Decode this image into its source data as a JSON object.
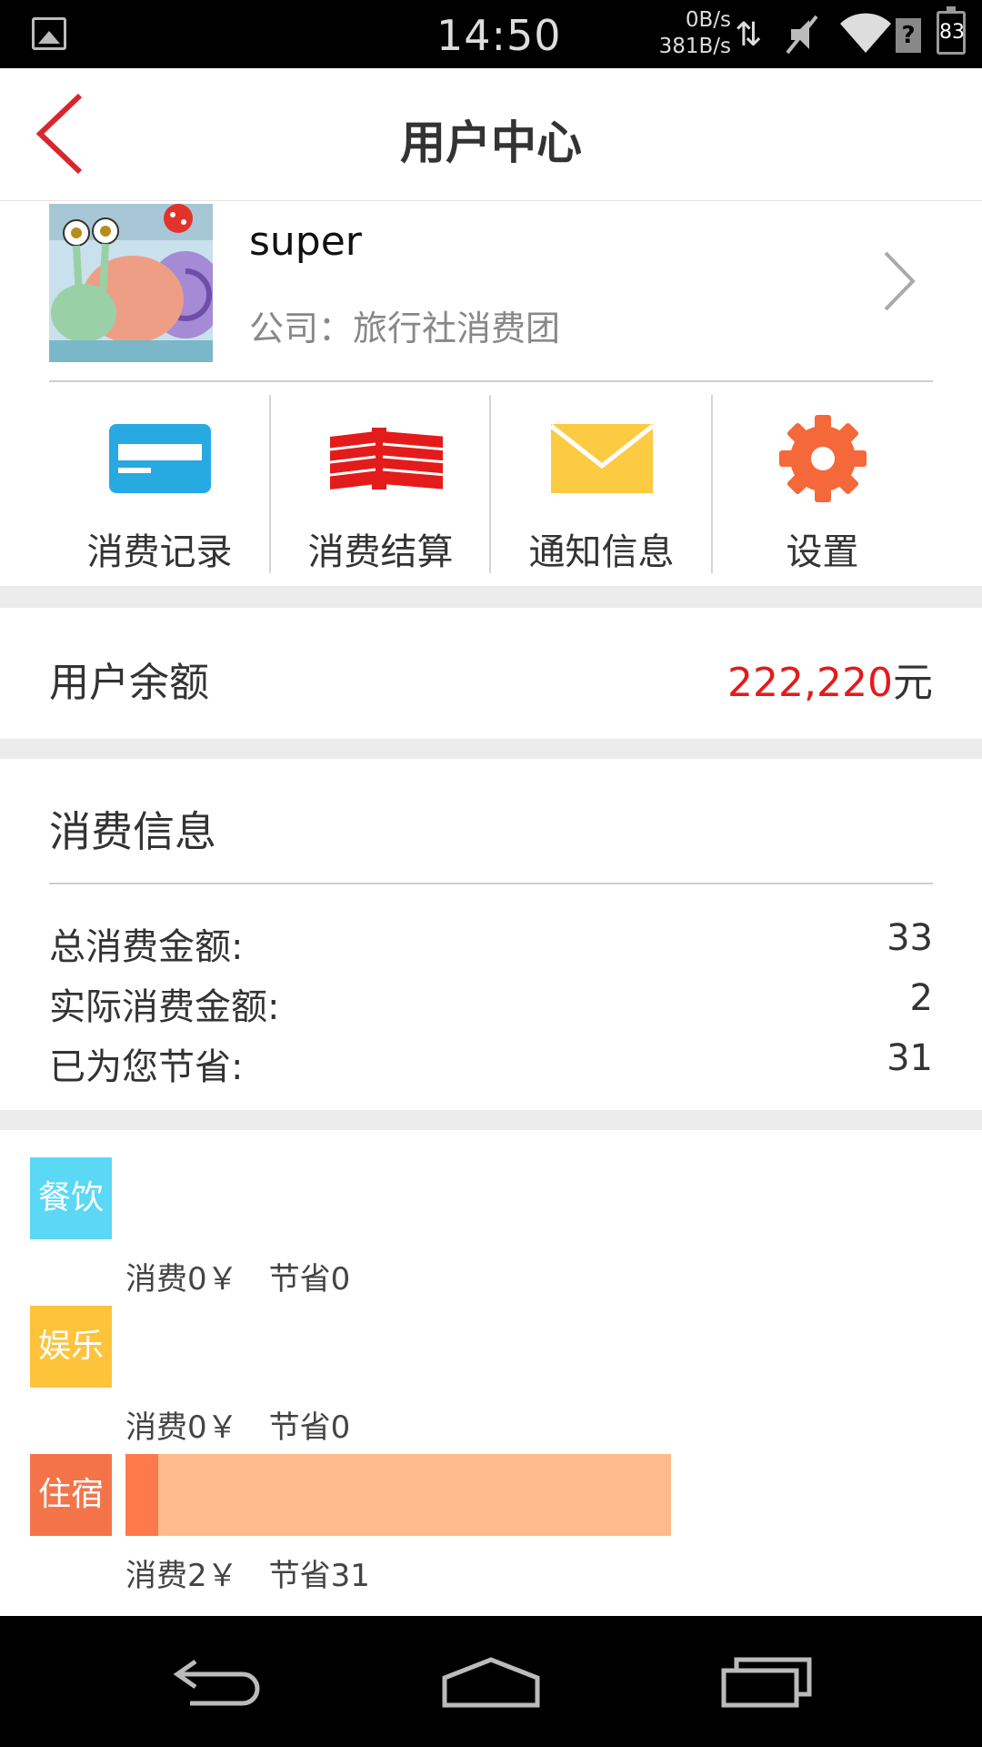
{
  "status_bar": {
    "time": "14:50",
    "net_up": "0B/s",
    "net_down": "381B/s",
    "battery": "83",
    "icons": [
      "image-notification-icon",
      "data-arrows-icon",
      "mute-icon",
      "wifi-icon",
      "sim-unknown-icon",
      "battery-icon"
    ]
  },
  "header": {
    "title": "用户中心",
    "back_icon": "back-chevron-icon",
    "accent_color": "#d9262e"
  },
  "profile": {
    "username": "super",
    "company": "公司：旅行社消费团",
    "avatar_icon": "snail-avatar",
    "chevron_icon": "chevron-right-icon"
  },
  "menu": {
    "items": [
      {
        "label": "消费记录",
        "icon": "card-icon",
        "color": "#27a9e1"
      },
      {
        "label": "消费结算",
        "icon": "money-stack-icon",
        "color": "#e41b1b"
      },
      {
        "label": "通知信息",
        "icon": "envelope-icon",
        "color": "#fdcb42"
      },
      {
        "label": "设置",
        "icon": "gear-icon",
        "color": "#f4683a"
      }
    ]
  },
  "balance": {
    "label": "用户余额",
    "amount": "222,220",
    "unit": "元",
    "amount_color": "#e41b1b"
  },
  "consumption": {
    "title": "消费信息",
    "rows": [
      {
        "label": "总消费金额:",
        "value": "33"
      },
      {
        "label": "实际消费金额:",
        "value": "2"
      },
      {
        "label": "已为您节省:",
        "value": "31"
      }
    ]
  },
  "categories": [
    {
      "tag": "餐饮",
      "color": "#5ad8f5",
      "spend": "消费0￥",
      "save": "节省0",
      "spend_value": 0,
      "save_value": 0
    },
    {
      "tag": "娱乐",
      "color": "#fdc43b",
      "spend": "消费0￥",
      "save": "节省0",
      "spend_value": 0,
      "save_value": 0
    },
    {
      "tag": "住宿",
      "color": "#f4744a",
      "spend": "消费2￥",
      "save": "节省31",
      "spend_value": 2,
      "save_value": 31
    }
  ],
  "nav_bar": {
    "icons": [
      "back-nav-icon",
      "home-nav-icon",
      "recents-nav-icon"
    ]
  }
}
